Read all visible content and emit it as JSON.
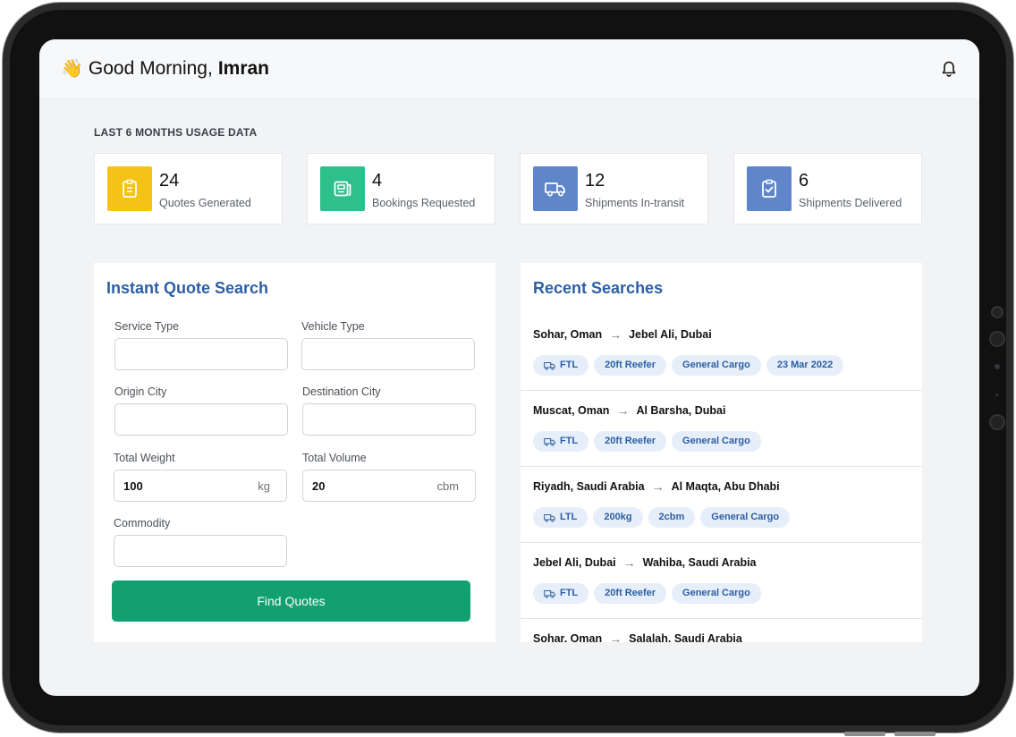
{
  "header": {
    "greeting": "Good Morning,",
    "user_name": "Imran",
    "wave_emoji": "👋",
    "bell_icon": "bell-icon"
  },
  "usage": {
    "section_label": "LAST 6 MONTHS USAGE DATA",
    "stats": [
      {
        "value": "24",
        "label": "Quotes Generated",
        "icon": "clipboard-icon",
        "color": "#f5c218"
      },
      {
        "value": "4",
        "label": "Bookings Requested",
        "icon": "document-icon",
        "color": "#2dbf8c"
      },
      {
        "value": "12",
        "label": "Shipments In-transit",
        "icon": "truck-icon",
        "color": "#5f86c9"
      },
      {
        "value": "6",
        "label": "Shipments Delivered",
        "icon": "clipboard-check-icon",
        "color": "#5f86c9"
      }
    ]
  },
  "quote_search": {
    "title": "Instant Quote Search",
    "service_type_label": "Service Type",
    "vehicle_type_label": "Vehicle Type",
    "origin_city_label": "Origin City",
    "destination_city_label": "Destination City",
    "total_weight_label": "Total Weight",
    "total_weight_value": "100",
    "total_weight_unit": "kg",
    "total_volume_label": "Total Volume",
    "total_volume_value": "20",
    "total_volume_unit": "cbm",
    "commodity_label": "Commodity",
    "find_button": "Find Quotes"
  },
  "recent_searches": {
    "title": "Recent Searches",
    "items": [
      {
        "from": "Sohar, Oman",
        "to": "Jebel Ali, Dubai",
        "mode": "FTL",
        "tags": [
          "20ft Reefer",
          "General Cargo",
          "23 Mar 2022"
        ]
      },
      {
        "from": "Muscat, Oman",
        "to": "Al Barsha, Dubai",
        "mode": "FTL",
        "tags": [
          "20ft Reefer",
          "General Cargo"
        ]
      },
      {
        "from": "Riyadh, Saudi Arabia",
        "to": "Al Maqta, Abu Dhabi",
        "mode": "LTL",
        "tags": [
          "200kg",
          "2cbm",
          "General Cargo"
        ]
      },
      {
        "from": "Jebel Ali, Dubai",
        "to": "Wahiba, Saudi Arabia",
        "mode": "FTL",
        "tags": [
          "20ft Reefer",
          "General Cargo"
        ]
      },
      {
        "from": "Sohar, Oman",
        "to": "Salalah, Saudi Arabia",
        "mode": "",
        "tags": []
      }
    ]
  },
  "colors": {
    "accent_blue": "#2c5fa4",
    "button_green": "#12a070",
    "tag_bg": "#e6eef9"
  }
}
